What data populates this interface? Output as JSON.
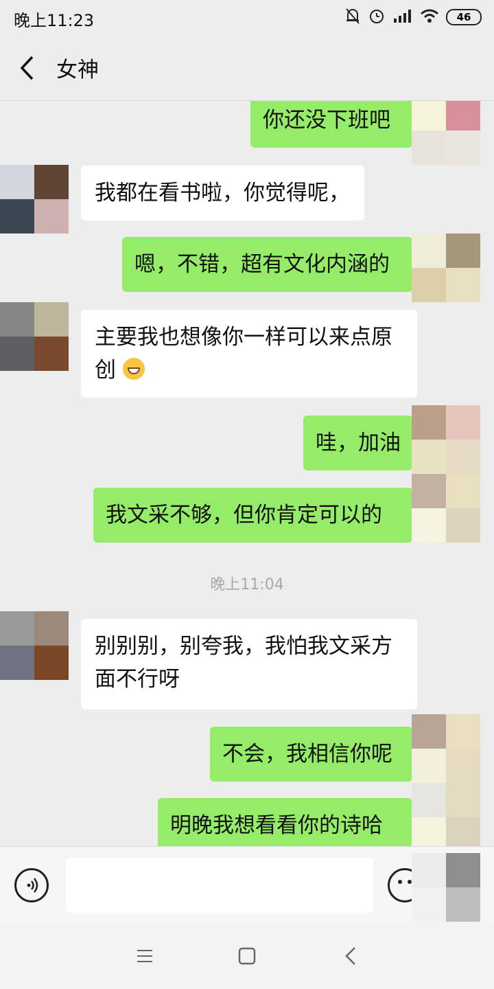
{
  "status_bar": {
    "time": "晚上11:23",
    "battery": "46",
    "icons": [
      "mute-bell-icon",
      "alarm-icon",
      "hd-signal-icon",
      "wifi-icon",
      "battery-icon"
    ]
  },
  "header": {
    "title": "女神",
    "back_icon": "chevron-left-icon"
  },
  "messages": [
    {
      "side": "out",
      "text": "你还没下班吧"
    },
    {
      "side": "in",
      "text": "我都在看书啦，你觉得呢，"
    },
    {
      "side": "out",
      "text": "嗯，不错，超有文化内涵的"
    },
    {
      "side": "in",
      "text": "主要我也想像你一样可以来点原创",
      "emoji": "grin-emoji-icon"
    },
    {
      "side": "out",
      "text": "哇，加油"
    },
    {
      "side": "out",
      "text": "我文采不够，但你肯定可以的"
    },
    {
      "side": "in",
      "text": "别别别，别夸我，我怕我文采方面不行呀"
    },
    {
      "side": "out",
      "text": "不会，我相信你呢"
    },
    {
      "side": "out",
      "text": "明晚我想看看你的诗哈"
    }
  ],
  "timestamp": "晚上11:04",
  "input_bar": {
    "voice_icon": "voice-icon",
    "emoji_icon": "emoji-icon",
    "text_value": ""
  },
  "nav_bar": {
    "icons": [
      "menu-icon",
      "home-icon",
      "back-icon"
    ]
  },
  "colors": {
    "background": "#ededed",
    "outgoing_bubble": "#95ec69",
    "incoming_bubble": "#ffffff",
    "timestamp": "#a8a8a8"
  }
}
